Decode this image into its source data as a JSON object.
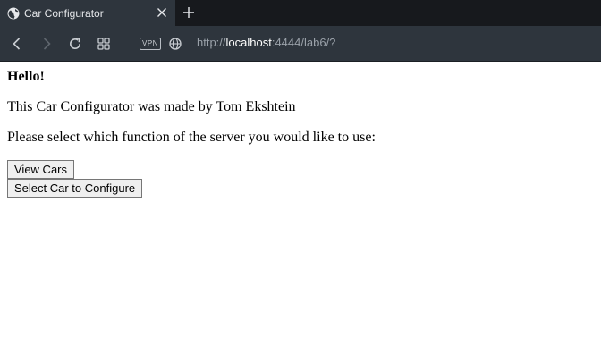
{
  "browser": {
    "tab": {
      "title": "Car Configurator",
      "favicon": "globe-icon",
      "close_icon": "close-icon"
    },
    "new_tab_icon": "plus-icon",
    "toolbar": {
      "back_icon": "chevron-left-icon",
      "forward_icon": "chevron-right-icon",
      "reload_icon": "reload-icon",
      "tabs_icon": "grid-icon",
      "vpn_label": "VPN",
      "site_icon": "globe-icon",
      "url_prefix": "http://",
      "url_host": "localhost",
      "url_suffix": ":4444/lab6/?"
    },
    "colors": {
      "tabstrip": "#17191d",
      "toolbar": "#2e353d",
      "page_bg": "#ffffff"
    }
  },
  "page": {
    "greeting": "Hello!",
    "author_line": "This Car Configurator was made by Tom Ekshtein",
    "instruction": "Please select which function of the server you would like to use:",
    "buttons": {
      "view_cars": "View Cars",
      "select_car": "Select Car to Configure"
    }
  }
}
